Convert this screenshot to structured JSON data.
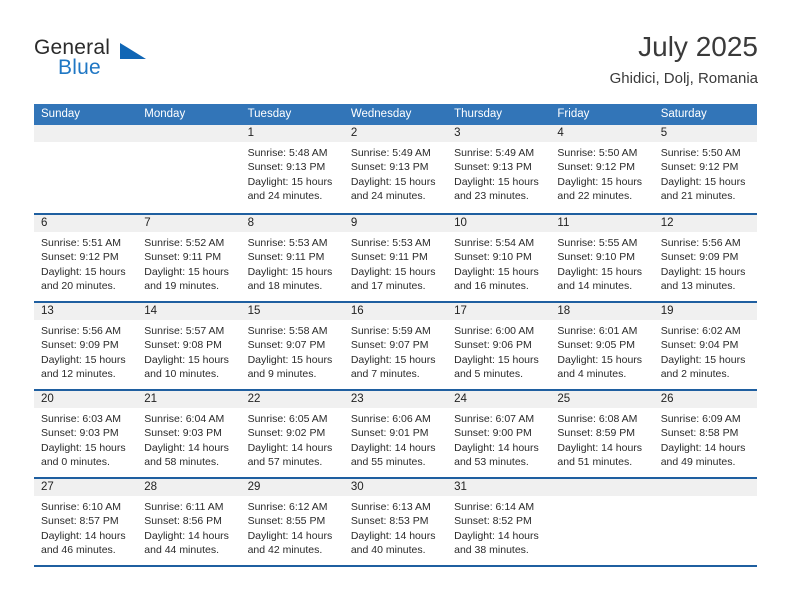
{
  "brand": {
    "name_top": "General",
    "name_bottom": "Blue",
    "triangle_icon": "triangle-icon",
    "accent_color": "#1f77c4",
    "triangle_color": "#1066b5"
  },
  "header": {
    "title": "July 2025",
    "location": "Ghidici, Dolj, Romania"
  },
  "theme": {
    "header_blue": "#3275b8",
    "separator_blue": "#1f5fa0",
    "daynum_band": "#f0f0f0"
  },
  "weekdays": [
    "Sunday",
    "Monday",
    "Tuesday",
    "Wednesday",
    "Thursday",
    "Friday",
    "Saturday"
  ],
  "weeks": [
    [
      {
        "day": "",
        "empty": true,
        "sunrise": "",
        "sunset": "",
        "daylight_1": "",
        "daylight_2": ""
      },
      {
        "day": "",
        "empty": true,
        "sunrise": "",
        "sunset": "",
        "daylight_1": "",
        "daylight_2": ""
      },
      {
        "day": "1",
        "sunrise": "Sunrise: 5:48 AM",
        "sunset": "Sunset: 9:13 PM",
        "daylight_1": "Daylight: 15 hours",
        "daylight_2": "and 24 minutes."
      },
      {
        "day": "2",
        "sunrise": "Sunrise: 5:49 AM",
        "sunset": "Sunset: 9:13 PM",
        "daylight_1": "Daylight: 15 hours",
        "daylight_2": "and 24 minutes."
      },
      {
        "day": "3",
        "sunrise": "Sunrise: 5:49 AM",
        "sunset": "Sunset: 9:13 PM",
        "daylight_1": "Daylight: 15 hours",
        "daylight_2": "and 23 minutes."
      },
      {
        "day": "4",
        "sunrise": "Sunrise: 5:50 AM",
        "sunset": "Sunset: 9:12 PM",
        "daylight_1": "Daylight: 15 hours",
        "daylight_2": "and 22 minutes."
      },
      {
        "day": "5",
        "sunrise": "Sunrise: 5:50 AM",
        "sunset": "Sunset: 9:12 PM",
        "daylight_1": "Daylight: 15 hours",
        "daylight_2": "and 21 minutes."
      }
    ],
    [
      {
        "day": "6",
        "sunrise": "Sunrise: 5:51 AM",
        "sunset": "Sunset: 9:12 PM",
        "daylight_1": "Daylight: 15 hours",
        "daylight_2": "and 20 minutes."
      },
      {
        "day": "7",
        "sunrise": "Sunrise: 5:52 AM",
        "sunset": "Sunset: 9:11 PM",
        "daylight_1": "Daylight: 15 hours",
        "daylight_2": "and 19 minutes."
      },
      {
        "day": "8",
        "sunrise": "Sunrise: 5:53 AM",
        "sunset": "Sunset: 9:11 PM",
        "daylight_1": "Daylight: 15 hours",
        "daylight_2": "and 18 minutes."
      },
      {
        "day": "9",
        "sunrise": "Sunrise: 5:53 AM",
        "sunset": "Sunset: 9:11 PM",
        "daylight_1": "Daylight: 15 hours",
        "daylight_2": "and 17 minutes."
      },
      {
        "day": "10",
        "sunrise": "Sunrise: 5:54 AM",
        "sunset": "Sunset: 9:10 PM",
        "daylight_1": "Daylight: 15 hours",
        "daylight_2": "and 16 minutes."
      },
      {
        "day": "11",
        "sunrise": "Sunrise: 5:55 AM",
        "sunset": "Sunset: 9:10 PM",
        "daylight_1": "Daylight: 15 hours",
        "daylight_2": "and 14 minutes."
      },
      {
        "day": "12",
        "sunrise": "Sunrise: 5:56 AM",
        "sunset": "Sunset: 9:09 PM",
        "daylight_1": "Daylight: 15 hours",
        "daylight_2": "and 13 minutes."
      }
    ],
    [
      {
        "day": "13",
        "sunrise": "Sunrise: 5:56 AM",
        "sunset": "Sunset: 9:09 PM",
        "daylight_1": "Daylight: 15 hours",
        "daylight_2": "and 12 minutes."
      },
      {
        "day": "14",
        "sunrise": "Sunrise: 5:57 AM",
        "sunset": "Sunset: 9:08 PM",
        "daylight_1": "Daylight: 15 hours",
        "daylight_2": "and 10 minutes."
      },
      {
        "day": "15",
        "sunrise": "Sunrise: 5:58 AM",
        "sunset": "Sunset: 9:07 PM",
        "daylight_1": "Daylight: 15 hours",
        "daylight_2": "and 9 minutes."
      },
      {
        "day": "16",
        "sunrise": "Sunrise: 5:59 AM",
        "sunset": "Sunset: 9:07 PM",
        "daylight_1": "Daylight: 15 hours",
        "daylight_2": "and 7 minutes."
      },
      {
        "day": "17",
        "sunrise": "Sunrise: 6:00 AM",
        "sunset": "Sunset: 9:06 PM",
        "daylight_1": "Daylight: 15 hours",
        "daylight_2": "and 5 minutes."
      },
      {
        "day": "18",
        "sunrise": "Sunrise: 6:01 AM",
        "sunset": "Sunset: 9:05 PM",
        "daylight_1": "Daylight: 15 hours",
        "daylight_2": "and 4 minutes."
      },
      {
        "day": "19",
        "sunrise": "Sunrise: 6:02 AM",
        "sunset": "Sunset: 9:04 PM",
        "daylight_1": "Daylight: 15 hours",
        "daylight_2": "and 2 minutes."
      }
    ],
    [
      {
        "day": "20",
        "sunrise": "Sunrise: 6:03 AM",
        "sunset": "Sunset: 9:03 PM",
        "daylight_1": "Daylight: 15 hours",
        "daylight_2": "and 0 minutes."
      },
      {
        "day": "21",
        "sunrise": "Sunrise: 6:04 AM",
        "sunset": "Sunset: 9:03 PM",
        "daylight_1": "Daylight: 14 hours",
        "daylight_2": "and 58 minutes."
      },
      {
        "day": "22",
        "sunrise": "Sunrise: 6:05 AM",
        "sunset": "Sunset: 9:02 PM",
        "daylight_1": "Daylight: 14 hours",
        "daylight_2": "and 57 minutes."
      },
      {
        "day": "23",
        "sunrise": "Sunrise: 6:06 AM",
        "sunset": "Sunset: 9:01 PM",
        "daylight_1": "Daylight: 14 hours",
        "daylight_2": "and 55 minutes."
      },
      {
        "day": "24",
        "sunrise": "Sunrise: 6:07 AM",
        "sunset": "Sunset: 9:00 PM",
        "daylight_1": "Daylight: 14 hours",
        "daylight_2": "and 53 minutes."
      },
      {
        "day": "25",
        "sunrise": "Sunrise: 6:08 AM",
        "sunset": "Sunset: 8:59 PM",
        "daylight_1": "Daylight: 14 hours",
        "daylight_2": "and 51 minutes."
      },
      {
        "day": "26",
        "sunrise": "Sunrise: 6:09 AM",
        "sunset": "Sunset: 8:58 PM",
        "daylight_1": "Daylight: 14 hours",
        "daylight_2": "and 49 minutes."
      }
    ],
    [
      {
        "day": "27",
        "sunrise": "Sunrise: 6:10 AM",
        "sunset": "Sunset: 8:57 PM",
        "daylight_1": "Daylight: 14 hours",
        "daylight_2": "and 46 minutes."
      },
      {
        "day": "28",
        "sunrise": "Sunrise: 6:11 AM",
        "sunset": "Sunset: 8:56 PM",
        "daylight_1": "Daylight: 14 hours",
        "daylight_2": "and 44 minutes."
      },
      {
        "day": "29",
        "sunrise": "Sunrise: 6:12 AM",
        "sunset": "Sunset: 8:55 PM",
        "daylight_1": "Daylight: 14 hours",
        "daylight_2": "and 42 minutes."
      },
      {
        "day": "30",
        "sunrise": "Sunrise: 6:13 AM",
        "sunset": "Sunset: 8:53 PM",
        "daylight_1": "Daylight: 14 hours",
        "daylight_2": "and 40 minutes."
      },
      {
        "day": "31",
        "sunrise": "Sunrise: 6:14 AM",
        "sunset": "Sunset: 8:52 PM",
        "daylight_1": "Daylight: 14 hours",
        "daylight_2": "and 38 minutes."
      },
      {
        "day": "",
        "empty": true,
        "sunrise": "",
        "sunset": "",
        "daylight_1": "",
        "daylight_2": ""
      },
      {
        "day": "",
        "empty": true,
        "sunrise": "",
        "sunset": "",
        "daylight_1": "",
        "daylight_2": ""
      }
    ]
  ]
}
